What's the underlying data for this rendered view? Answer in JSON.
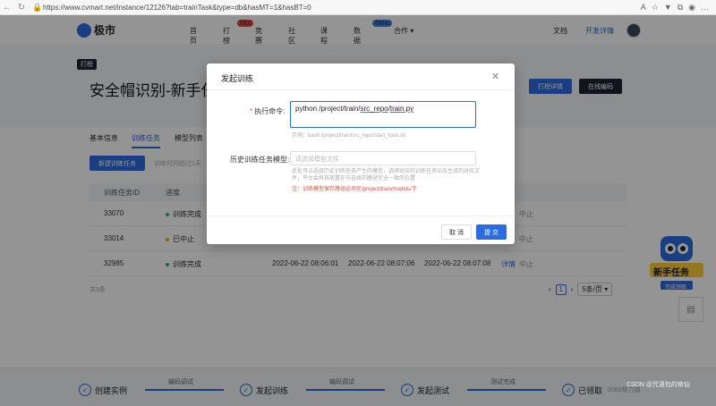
{
  "browser": {
    "url": "https://www.cvmart.net/instance/12126?tab=trainTask&type=db&hasMT=1&hasBT=0"
  },
  "nav": {
    "logo": "极市",
    "items": [
      "首页",
      "打榜",
      "竞赛",
      "社区",
      "课程",
      "数据集",
      "合作"
    ],
    "badge_hot": "Hot",
    "badge_new": "New",
    "doc": "文档",
    "dev": "开发详情"
  },
  "header": {
    "tag": "打榜",
    "title": "安全帽识别-新手任务",
    "btn_detail": "打榜详情",
    "btn_online": "在线编码"
  },
  "tabs": [
    "基本信息",
    "训练任务",
    "模型列表"
  ],
  "toolbar": {
    "new_task": "新建训练任务",
    "hint": "训练时间超过1天"
  },
  "table": {
    "headers": [
      "训练任务ID",
      "进度"
    ],
    "rows": [
      {
        "id": "33070",
        "status": "训练完成",
        "status_color": "#36b37e",
        "c1": "",
        "c2": "",
        "c3": "",
        "action": "中止"
      },
      {
        "id": "33014",
        "status": "已中止",
        "status_color": "#f5a623",
        "c1": "",
        "c2": "",
        "c3": "",
        "action": "中止"
      },
      {
        "id": "32985",
        "status": "训练完成",
        "status_color": "#36b37e",
        "c1": "2022-06-22 08:06:01",
        "c2": "2022-06-22 08:07:06",
        "c3": "2022-06-22 08:07:08",
        "action": "详情",
        "action2": "中止"
      }
    ]
  },
  "pagination": {
    "total": "共3条",
    "page": "1",
    "size": "5条/页"
  },
  "bottom_steps": [
    {
      "label": "创建实例"
    },
    {
      "label": "发起训练"
    },
    {
      "label": "发起测试"
    },
    {
      "label": "已领取",
      "sub": "2000极力值"
    }
  ],
  "step_connectors": [
    "编码调试",
    "编码调试",
    "测试完成"
  ],
  "promo": "新手任务",
  "promo_sub": "完成领取",
  "watermark": "CSDN @咒语包的修仙",
  "modal": {
    "title": "发起训练",
    "cmd_label": "执行命令:",
    "cmd_prefix": "python  /project/train/",
    "cmd_src": "src_repo",
    "cmd_sep": "/",
    "cmd_file": "train.py",
    "example": "示例：bash /project/train/src_repo/start_train.sh",
    "history_label": "历史训练任务模型:",
    "history_placeholder": "请选择模型文件",
    "help": "此处可以选择历史训练任务产生的模型，选择对应的训练任务ID及生成的对应文件，平台会将其放置在与选择的路径完全一致的位置",
    "note": "注：训练模型保存路径必须在/project/train/models/下",
    "cancel": "取 消",
    "submit": "提 交"
  }
}
